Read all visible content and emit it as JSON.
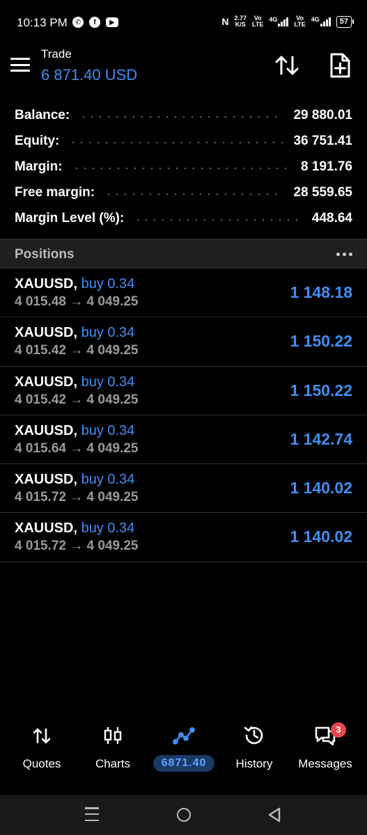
{
  "status_bar": {
    "time": "10:13 PM",
    "left_icons": [
      "whatsapp-icon",
      "facebook-icon",
      "youtube-icon"
    ],
    "nfc": "N",
    "net_speed_value": "2.77",
    "net_speed_unit": "K/S",
    "sim1_label_top": "Vo",
    "sim1_label_bottom": "LTE",
    "sim1_network": "4G",
    "sim2_label_top": "Vo",
    "sim2_label_bottom": "LTE",
    "sim2_network": "4G",
    "battery": "57"
  },
  "header": {
    "title": "Trade",
    "subtitle": "6 871.40 USD",
    "menu_icon": "menu-icon",
    "sort_icon": "sort-arrows-icon",
    "new_order_icon": "new-order-icon"
  },
  "summary": [
    {
      "label": "Balance:",
      "value": "29 880.01"
    },
    {
      "label": "Equity:",
      "value": "36 751.41"
    },
    {
      "label": "Margin:",
      "value": "8 191.76"
    },
    {
      "label": "Free margin:",
      "value": "28 559.65"
    },
    {
      "label": "Margin Level (%):",
      "value": "448.64"
    }
  ],
  "positions_section": {
    "title": "Positions",
    "more_icon": "more-horizontal-icon"
  },
  "positions": [
    {
      "symbol": "XAUUSD,",
      "side": "buy 0.34",
      "open": "4 015.48",
      "arrow": "→",
      "current": "4 049.25",
      "profit": "1 148.18"
    },
    {
      "symbol": "XAUUSD,",
      "side": "buy 0.34",
      "open": "4 015.42",
      "arrow": "→",
      "current": "4 049.25",
      "profit": "1 150.22"
    },
    {
      "symbol": "XAUUSD,",
      "side": "buy 0.34",
      "open": "4 015.42",
      "arrow": "→",
      "current": "4 049.25",
      "profit": "1 150.22"
    },
    {
      "symbol": "XAUUSD,",
      "side": "buy 0.34",
      "open": "4 015.64",
      "arrow": "→",
      "current": "4 049.25",
      "profit": "1 142.74"
    },
    {
      "symbol": "XAUUSD,",
      "side": "buy 0.34",
      "open": "4 015.72",
      "arrow": "→",
      "current": "4 049.25",
      "profit": "1 140.02"
    },
    {
      "symbol": "XAUUSD,",
      "side": "buy 0.34",
      "open": "4 015.72",
      "arrow": "→",
      "current": "4 049.25",
      "profit": "1 140.02"
    }
  ],
  "bottom_nav": {
    "quotes": {
      "label": "Quotes",
      "icon": "quotes-arrows-icon"
    },
    "charts": {
      "label": "Charts",
      "icon": "candlestick-icon"
    },
    "trade": {
      "label": "6871.40",
      "icon": "trade-line-icon",
      "active": true
    },
    "history": {
      "label": "History",
      "icon": "history-clock-icon"
    },
    "messages": {
      "label": "Messages",
      "icon": "messages-icon",
      "badge": "3"
    }
  },
  "colors": {
    "background": "#000000",
    "accent_blue": "#3f8ff5",
    "muted_text": "#9a9a9a",
    "section_header_bg": "#1f1f1f",
    "badge_red": "#e5484d"
  }
}
